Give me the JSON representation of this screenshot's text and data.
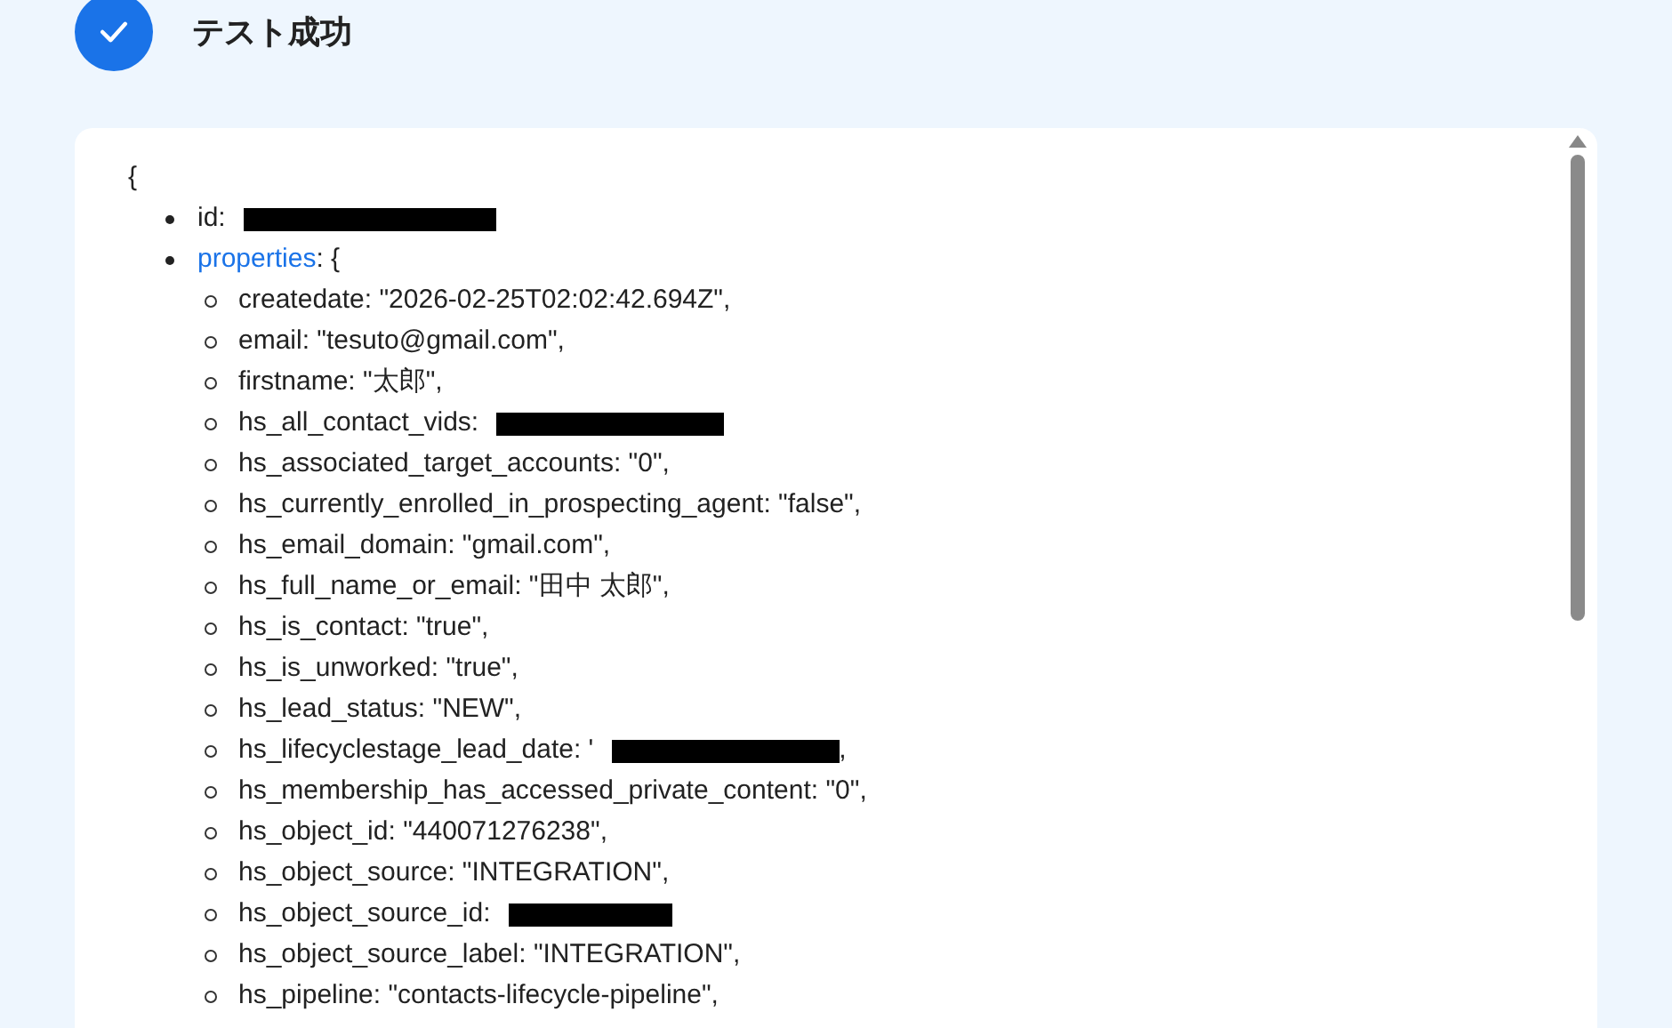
{
  "header": {
    "title": "テスト成功",
    "success": true
  },
  "output": {
    "open_brace": "{",
    "fields": [
      {
        "key": "id:",
        "redacted": true
      },
      {
        "key": "properties",
        "link": true,
        "after": ": {",
        "children": [
          {
            "key": "createdate:",
            "value": "\"2026-02-25T02:02:42.694Z\","
          },
          {
            "key": "email:",
            "value": "\"tesuto@gmail.com\","
          },
          {
            "key": "firstname:",
            "value": "\"太郎\","
          },
          {
            "key": "hs_all_contact_vids:",
            "redacted": true
          },
          {
            "key": "hs_associated_target_accounts:",
            "value": "\"0\","
          },
          {
            "key": "hs_currently_enrolled_in_prospecting_agent:",
            "value": "\"false\","
          },
          {
            "key": "hs_email_domain:",
            "value": "\"gmail.com\","
          },
          {
            "key": "hs_full_name_or_email:",
            "value": "\"田中 太郎\","
          },
          {
            "key": "hs_is_contact:",
            "value": "\"true\","
          },
          {
            "key": "hs_is_unworked:",
            "value": "\"true\","
          },
          {
            "key": "hs_lead_status:",
            "value": "\"NEW\","
          },
          {
            "key": "hs_lifecyclestage_lead_date:",
            "value": "'",
            "redacted": true,
            "after": ","
          },
          {
            "key": "hs_membership_has_accessed_private_content:",
            "value": "\"0\","
          },
          {
            "key": "hs_object_id:",
            "value": "\"440071276238\","
          },
          {
            "key": "hs_object_source:",
            "value": "\"INTEGRATION\","
          },
          {
            "key": "hs_object_source_id:",
            "redacted": true
          },
          {
            "key": "hs_object_source_label:",
            "value": "\"INTEGRATION\","
          },
          {
            "key": "hs_pipeline:",
            "value": "\"contacts-lifecycle-pipeline\","
          }
        ]
      }
    ]
  }
}
